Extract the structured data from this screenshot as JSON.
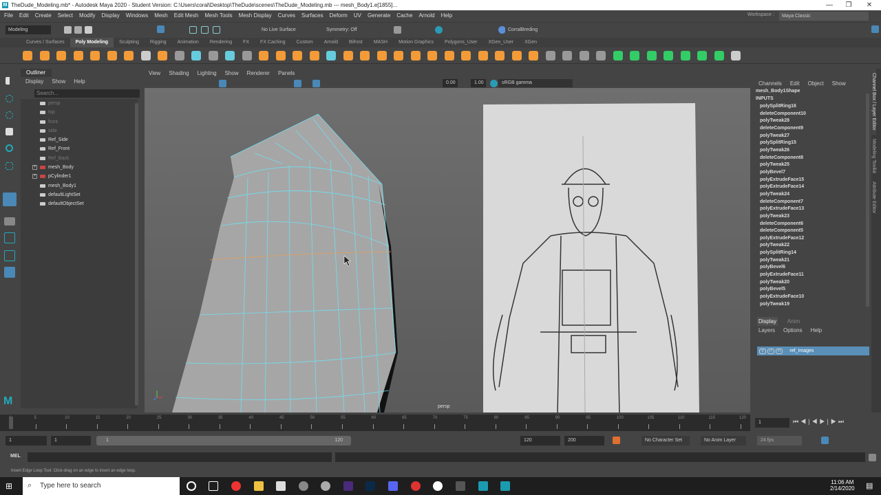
{
  "window": {
    "title": "TheDude_Modeling.mb* - Autodesk Maya 2020 - Student Version: C:\\Users\\coral\\Desktop\\TheDude\\scenes\\TheDude_Modeling.mb  ---  mesh_Body1.e[1855]...",
    "minimize": "—",
    "restore": "❐",
    "close": "✕"
  },
  "menu": [
    "File",
    "Edit",
    "Create",
    "Select",
    "Modify",
    "Display",
    "Windows",
    "Mesh",
    "Edit Mesh",
    "Mesh Tools",
    "Mesh Display",
    "Curves",
    "Surfaces",
    "Deform",
    "UV",
    "Generate",
    "Cache",
    "Arnold",
    "Help"
  ],
  "workspace": {
    "label": "Workspace :",
    "value": "Maya Classic"
  },
  "status": {
    "menuset": "Modeling",
    "live_surface": "No Live Surface",
    "symmetry": "Symmetry: Off",
    "user": "CorralBreding"
  },
  "shelf_tabs": [
    "Curves / Surfaces",
    "Poly Modeling",
    "Sculpting",
    "Rigging",
    "Animation",
    "Rendering",
    "FX",
    "FX Caching",
    "Custom",
    "Arnold",
    "Bifrost",
    "MASH",
    "Motion Graphics",
    "Polygons_User",
    "XGen_User",
    "XGen"
  ],
  "outliner": {
    "title": "Outliner",
    "menu": [
      "Display",
      "Show",
      "Help"
    ],
    "search_placeholder": "Search...",
    "items": [
      {
        "label": "persp",
        "dim": true
      },
      {
        "label": "top",
        "dim": true
      },
      {
        "label": "front",
        "dim": true
      },
      {
        "label": "side",
        "dim": true
      },
      {
        "label": "Ref_Side"
      },
      {
        "label": "Ref_Front"
      },
      {
        "label": "Ref_Back",
        "dim": true
      },
      {
        "label": "mesh_Body",
        "exp": true
      },
      {
        "label": "pCylinder1",
        "exp": true
      },
      {
        "label": "mesh_Body1"
      },
      {
        "label": "defaultLightSet"
      },
      {
        "label": "defaultObjectSet"
      }
    ]
  },
  "viewport": {
    "menu": [
      "View",
      "Shading",
      "Lighting",
      "Show",
      "Renderer",
      "Panels"
    ],
    "exposure": "0.00",
    "gamma": "1.00",
    "colorspace": "sRGB gamma",
    "camera": "persp"
  },
  "channelbox": {
    "menu": [
      "Channels",
      "Edit",
      "Object",
      "Show"
    ],
    "shape": "mesh_Body1Shape",
    "inputs_label": "INPUTS",
    "inputs": [
      "polySplitRing16",
      "deleteComponent10",
      "polyTweak28",
      "deleteComponent9",
      "polyTweak27",
      "polySplitRing15",
      "polyTweak26",
      "deleteComponent8",
      "polyTweak25",
      "polyBevel7",
      "polyExtrudeFace15",
      "polyExtrudeFace14",
      "polyTweak24",
      "deleteComponent7",
      "polyExtrudeFace13",
      "polyTweak23",
      "deleteComponent6",
      "deleteComponent5",
      "polyExtrudeFace12",
      "polyTweak22",
      "polySplitRing14",
      "polyTweak21",
      "polyBevel6",
      "polyExtrudeFace11",
      "polyTweak20",
      "polyBevel5",
      "polyExtrudeFace10",
      "polyTweak19"
    ]
  },
  "layers": {
    "tabs": [
      "Display",
      "Anim"
    ],
    "menu": [
      "Layers",
      "Options",
      "Help"
    ],
    "layer": {
      "v": "V",
      "p": "P",
      "r": "R",
      "name": "ref_Images"
    }
  },
  "side_tabs": [
    "Channel Box / Layer Editor",
    "Modeling Toolkit",
    "Attribute Editor"
  ],
  "timeline": {
    "ticks": [
      "1",
      "5",
      "10",
      "15",
      "20",
      "25",
      "30",
      "35",
      "40",
      "45",
      "50",
      "55",
      "60",
      "65",
      "70",
      "75",
      "80",
      "85",
      "90",
      "95",
      "100",
      "105",
      "110",
      "115",
      "120"
    ],
    "current": "1"
  },
  "range": {
    "start": "1",
    "anim_start": "1",
    "slider_start": "1",
    "slider_end": "120",
    "end": "120",
    "anim_end": "200",
    "character_set": "No Character Set",
    "anim_layer": "No Anim Layer",
    "fps": "24 fps"
  },
  "mel": {
    "label": "MEL"
  },
  "helpline": "Insert Edge Loop Tool: Click-drag on an edge to insert an edge loop.",
  "taskbar": {
    "search": "Type here to search",
    "time": "11:06 AM",
    "date": "2/14/2020"
  }
}
